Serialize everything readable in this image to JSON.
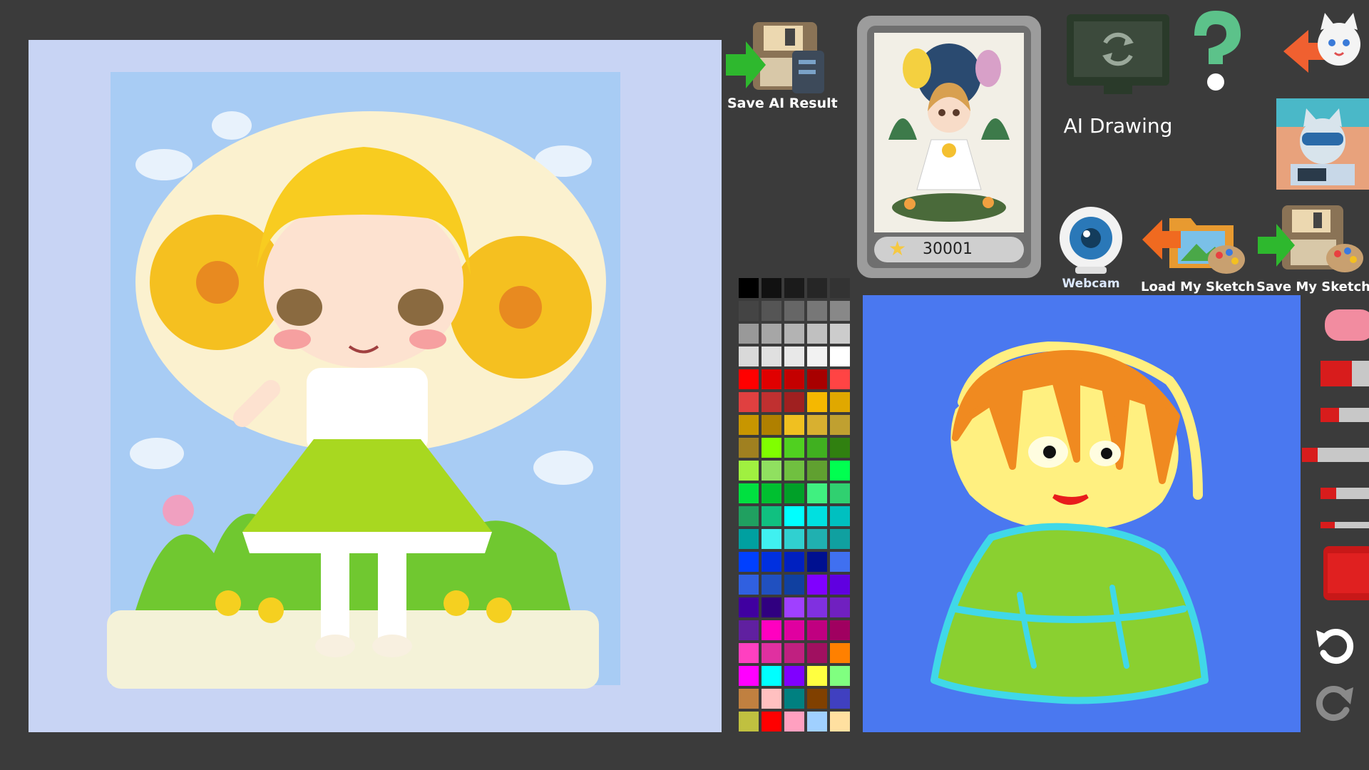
{
  "toolbar": {
    "save_ai_result": "Save AI Result",
    "ai_drawing": "AI Drawing",
    "webcam": "Webcam",
    "load_my_sketch": "Load My Sketch",
    "save_my_sketch": "Save My Sketch"
  },
  "gallery": {
    "score": "30001"
  },
  "icons": {
    "save_ai_result": "floppy-disk-icon",
    "refresh": "refresh-monitor-icon",
    "help": "question-mark-icon",
    "back": "cat-back-arrow-icon",
    "avatar": "cat-avatar-icon",
    "webcam": "webcam-icon",
    "load_sketch": "folder-palette-icon",
    "save_sketch": "floppy-palette-icon",
    "undo": "undo-icon",
    "redo": "redo-icon"
  },
  "palette": [
    "#000000",
    "#111111",
    "#1b1b1b",
    "#262626",
    "#333333",
    "#444444",
    "#555555",
    "#666666",
    "#777777",
    "#888888",
    "#999999",
    "#a6a6a6",
    "#b3b3b3",
    "#c0c0c0",
    "#cccccc",
    "#d9d9d9",
    "#e0e0e0",
    "#e8e8e8",
    "#f2f2f2",
    "#ffffff",
    "#ff0000",
    "#e00000",
    "#c40000",
    "#a80000",
    "#ff4444",
    "#e04040",
    "#c03030",
    "#a02020",
    "#f5b800",
    "#e0a800",
    "#c89600",
    "#b08000",
    "#f0c020",
    "#d8b030",
    "#c0a030",
    "#a08020",
    "#80ff00",
    "#50d020",
    "#40b020",
    "#308010",
    "#a0f040",
    "#90e060",
    "#70c040",
    "#60a030",
    "#00ff50",
    "#00e040",
    "#00c030",
    "#00a028",
    "#40f080",
    "#30d070",
    "#20a060",
    "#10c080",
    "#00ffff",
    "#00e0e0",
    "#00c0c0",
    "#00a0a0",
    "#40f0f0",
    "#30d0d0",
    "#20b0b0",
    "#10a0a0",
    "#0040ff",
    "#0030e0",
    "#0020c0",
    "#001090",
    "#4070f0",
    "#3060e0",
    "#2050c0",
    "#1040a0",
    "#8000ff",
    "#6000e0",
    "#4000a0",
    "#300080",
    "#a040ff",
    "#8030e0",
    "#7020c0",
    "#6020a0",
    "#ff00c0",
    "#e000a0",
    "#c00080",
    "#a00060",
    "#ff40c0",
    "#e030a0",
    "#c02080",
    "#a01060",
    "#ff8000",
    "#ff00ff",
    "#00ffff",
    "#8000ff",
    "#ffff40",
    "#80ff80",
    "#c08040",
    "#ffc0c0",
    "#008080",
    "#804000",
    "#4040c0",
    "#c0c040",
    "#ff0000",
    "#ffa0c0",
    "#a0d0ff",
    "#ffe0a0"
  ]
}
